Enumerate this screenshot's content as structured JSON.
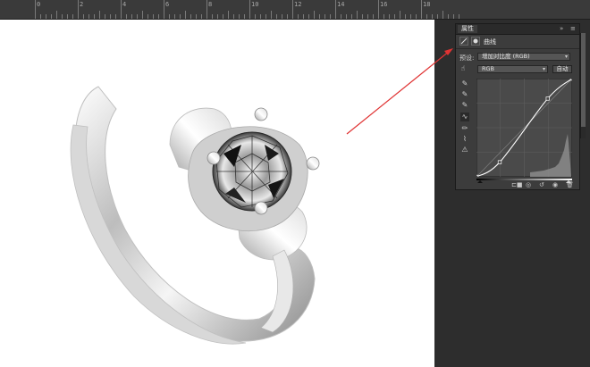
{
  "ruler": {
    "labels": [
      "0",
      "2",
      "4",
      "6",
      "8",
      "10",
      "12",
      "14",
      "16",
      "18"
    ]
  },
  "panel": {
    "tab_label": "属性",
    "header_label": "曲线",
    "preset_label": "预设:",
    "preset_value": "增加对比度 (RGB)",
    "channel_value": "RGB",
    "auto_button": "自动"
  },
  "icons": {
    "panel_menu": "double-chevron-right-icon",
    "tools": [
      "on-image-adjust-icon",
      "black-eyedropper-icon",
      "gray-eyedropper-icon",
      "white-eyedropper-icon",
      "curve-pencil-smooth-icon",
      "pencil-icon",
      "smooth-icon",
      "histogram-warning-icon"
    ]
  },
  "colors": {
    "arrow": "#e03333",
    "panel_bg": "#3c3c3c",
    "curve_line": "#ffffff",
    "histogram": "#8f8f8f"
  },
  "curve": {
    "points": [
      [
        0,
        0
      ],
      [
        62,
        38
      ],
      [
        190,
        203
      ],
      [
        255,
        255
      ]
    ]
  }
}
